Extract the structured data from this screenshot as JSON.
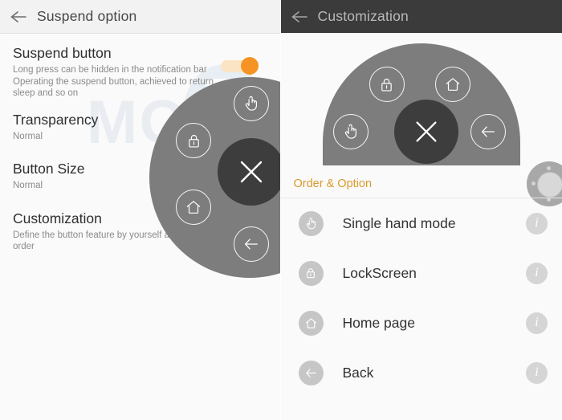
{
  "left_panel": {
    "header": {
      "title": "Suspend option",
      "back_icon": "back-arrow-icon"
    },
    "rows": [
      {
        "title": "Suspend button",
        "subtitle": "Long press can be hidden in the notification bar Operating the suspend button, achieved to return, sleep and so on",
        "toggle": {
          "state": "on",
          "color": "#f59324"
        }
      },
      {
        "title": "Transparency",
        "subtitle": "Normal"
      },
      {
        "title": "Button Size",
        "subtitle": "Normal"
      },
      {
        "title": "Customization",
        "subtitle": "Define the button feature by yourself and change the order"
      }
    ],
    "overlay": {
      "background_color": "#7d7d7d",
      "center_button": {
        "icon": "close-x-icon",
        "color": "#3d3d3d"
      },
      "buttons": [
        {
          "icon": "hand-pointer-icon",
          "name": "single-hand-mode"
        },
        {
          "icon": "lock-icon",
          "name": "lockscreen"
        },
        {
          "icon": "home-icon",
          "name": "home-page"
        },
        {
          "icon": "back-arrow-icon",
          "name": "back"
        }
      ]
    }
  },
  "right_panel": {
    "header": {
      "title": "Customization",
      "back_icon": "back-arrow-icon",
      "background_color": "#3b3b3b"
    },
    "preview": {
      "background_color": "#7d7d7d",
      "center_button": {
        "icon": "close-x-icon",
        "color": "#3d3d3d"
      },
      "buttons": [
        {
          "icon": "lock-icon",
          "name": "lockscreen"
        },
        {
          "icon": "home-icon",
          "name": "home-page"
        },
        {
          "icon": "hand-pointer-icon",
          "name": "single-hand-mode"
        },
        {
          "icon": "back-arrow-icon",
          "name": "back"
        }
      ]
    },
    "nav_ball": {
      "name": "floating-nav-ball"
    },
    "section": {
      "label": "Order & Option",
      "color": "#d79a2c"
    },
    "options": [
      {
        "icon": "hand-pointer-icon",
        "label": "Single hand mode",
        "info": "i"
      },
      {
        "icon": "lock-icon",
        "label": "LockScreen",
        "info": "i"
      },
      {
        "icon": "home-icon",
        "label": "Home page",
        "info": "i"
      },
      {
        "icon": "back-arrow-icon",
        "label": "Back",
        "info": "i"
      }
    ]
  },
  "watermark": {
    "text": "MOBIGYAAN"
  }
}
